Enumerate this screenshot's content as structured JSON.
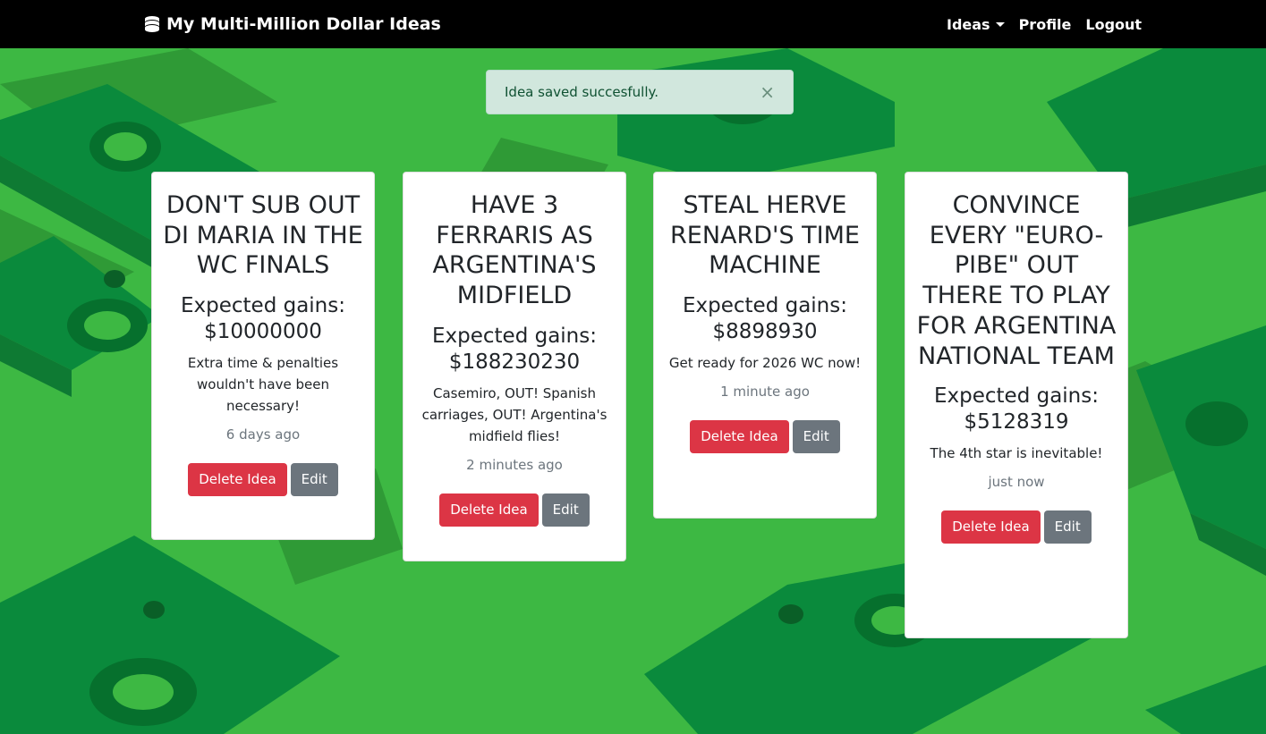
{
  "navbar": {
    "brand": "My Multi-Million Dollar Ideas",
    "links": [
      "Ideas",
      "Profile",
      "Logout"
    ]
  },
  "alert": {
    "message": "Idea saved succesfully.",
    "close": "×"
  },
  "ideas": [
    {
      "title": "DON'T SUB OUT DI MARIA IN THE WC FINALS",
      "gains_label": "Expected gains:",
      "gains_value": "$10000000",
      "description": "Extra time & penalties wouldn't have been necessary!",
      "time": "6 days ago",
      "delete_label": "Delete Idea",
      "edit_label": "Edit"
    },
    {
      "title": "HAVE 3 FERRARIS AS ARGENTINA'S MIDFIELD",
      "gains_label": "Expected gains:",
      "gains_value": "$188230230",
      "description": "Casemiro, OUT! Spanish carriages, OUT! Argentina's midfield flies!",
      "time": "2 minutes ago",
      "delete_label": "Delete Idea",
      "edit_label": "Edit"
    },
    {
      "title": "STEAL HERVE RENARD'S TIME MACHINE",
      "gains_label": "Expected gains:",
      "gains_value": "$8898930",
      "description": "Get ready for 2026 WC now!",
      "time": "1 minute ago",
      "delete_label": "Delete Idea",
      "edit_label": "Edit"
    },
    {
      "title": "CONVINCE EVERY \"EURO-PIBE\" OUT THERE TO PLAY FOR ARGENTINA NATIONAL TEAM",
      "gains_label": "Expected gains:",
      "gains_value": "$5128319",
      "description": "The 4th star is inevitable!",
      "time": "just now",
      "delete_label": "Delete Idea",
      "edit_label": "Edit"
    }
  ],
  "colors": {
    "background": "#3db843",
    "navbar": "#000000",
    "alert_bg": "#d1e7dd",
    "alert_text": "#0f5132",
    "danger": "#dc3545",
    "secondary": "#6c757d"
  },
  "icons": {
    "brand": "coins-icon",
    "ideas_dropdown": "caret-down-icon",
    "alert_close": "close-icon"
  }
}
